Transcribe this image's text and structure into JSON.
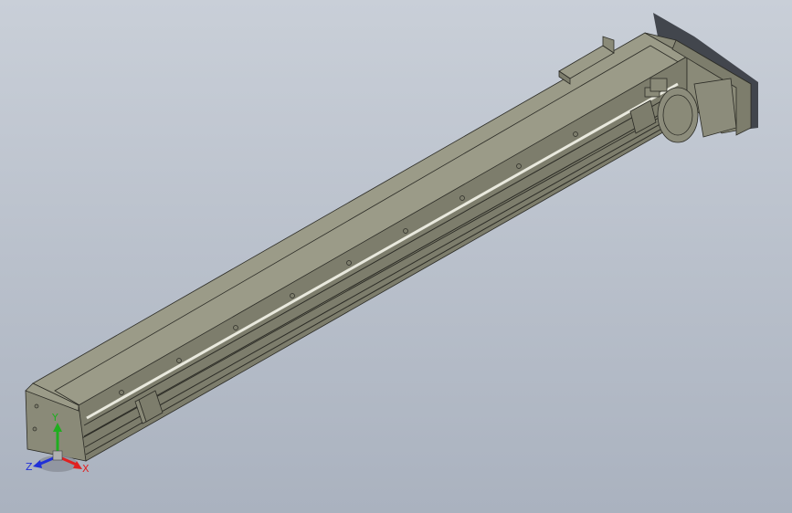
{
  "viewport": {
    "background_top": "#c9cfd8",
    "background_bottom": "#aab2bf",
    "model_colors": {
      "top_face": "#9b9b88",
      "side_face": "#7d7d6c",
      "front_face": "#8a8a78",
      "edge": "#2c2c26",
      "rail_highlight": "#e9e9de",
      "motor": "#8c8c7b"
    }
  },
  "triad": {
    "x_label": "X",
    "y_label": "Y",
    "z_label": "Z",
    "x_color": "#e02020",
    "y_color": "#1fae1f",
    "z_color": "#2030d8"
  }
}
